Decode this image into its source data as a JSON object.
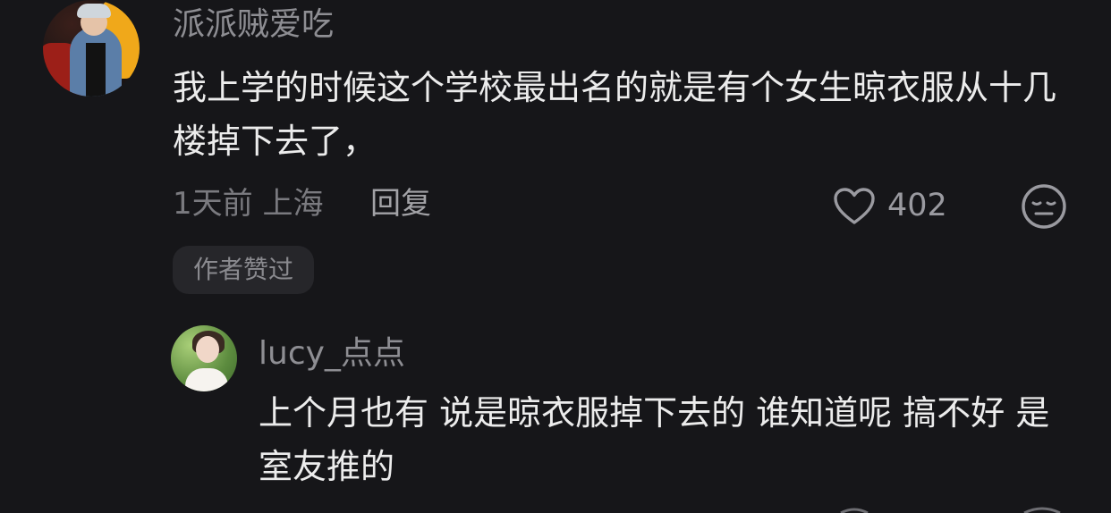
{
  "comment": {
    "username": "派派贼爱吃",
    "text": "我上学的时候这个学校最出名的就是有个女生晾衣服从十几楼掉下去了，",
    "meta": "1天前 上海",
    "reply_label": "回复",
    "likes": "402",
    "author_badge": "作者赞过"
  },
  "reply": {
    "username": "lucy_点点",
    "text": "上个月也有 说是晾衣服掉下去的 谁知道呢 搞不好 是室友推的"
  },
  "icons": {
    "like": "heart-icon",
    "emoji": "expressionless-face-icon"
  },
  "colors": {
    "background": "#161619",
    "primary_text": "#ececec",
    "secondary_text": "#8e8e93",
    "badge_bg": "#26262a"
  }
}
